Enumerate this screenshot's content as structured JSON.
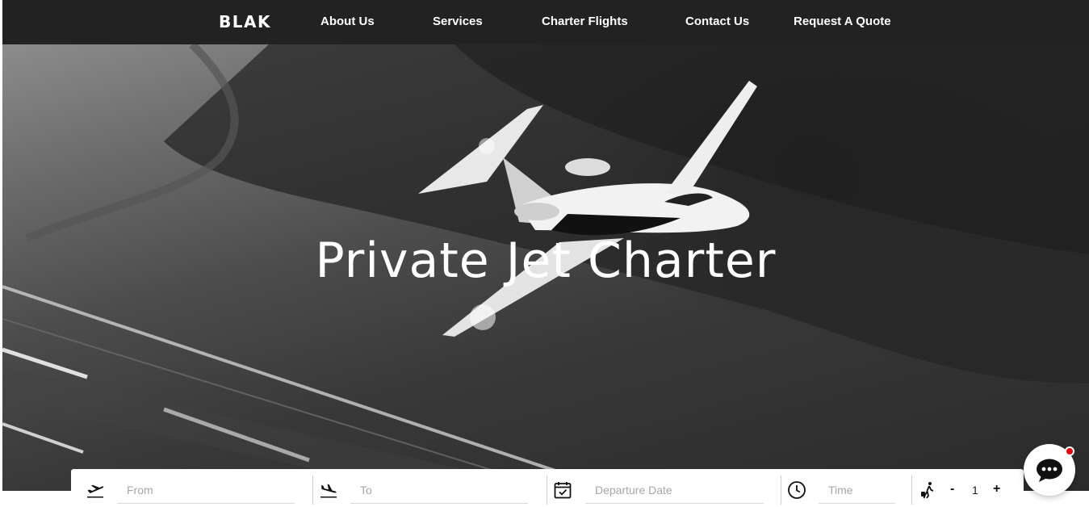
{
  "brand": "BLAK",
  "nav": {
    "items": [
      {
        "label": "About Us"
      },
      {
        "label": "Services"
      },
      {
        "label": "Charter Flights"
      },
      {
        "label": "Contact Us"
      },
      {
        "label": "Request A Quote"
      }
    ]
  },
  "hero": {
    "title": "Private Jet Charter"
  },
  "search": {
    "from": {
      "placeholder": "From",
      "icon": "takeoff-icon"
    },
    "to": {
      "placeholder": "To",
      "icon": "landing-icon"
    },
    "date": {
      "placeholder": "Departure Date",
      "icon": "calendar-icon"
    },
    "time": {
      "placeholder": "Time",
      "icon": "clock-icon"
    },
    "passengers": {
      "icon": "traveler-icon",
      "minus": "-",
      "count": "1",
      "plus": "+"
    }
  },
  "chat": {
    "icon": "chat-bubble-icon",
    "badge_color": "#e60012"
  },
  "colors": {
    "nav_bg": "#222223",
    "text": "#ffffff"
  }
}
